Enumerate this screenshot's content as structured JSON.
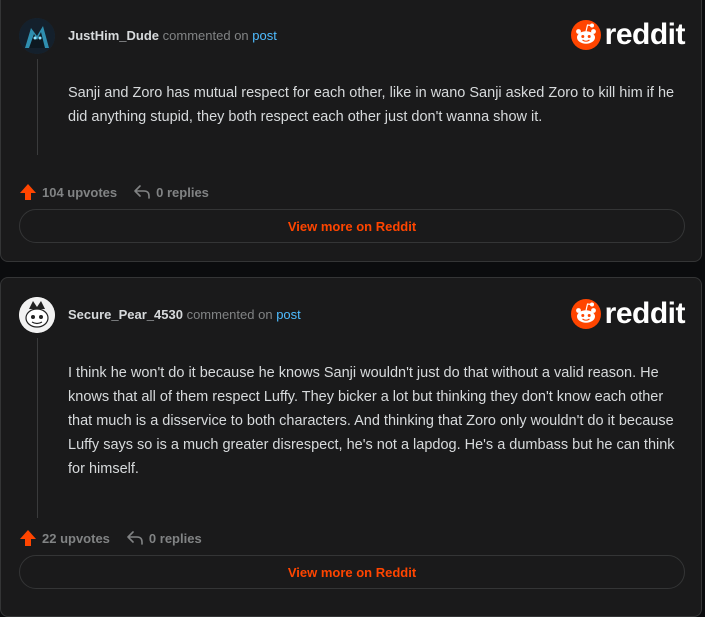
{
  "brand": {
    "wordmark": "reddit",
    "accent": "#ff4500",
    "link_color": "#4fbcff"
  },
  "comments": [
    {
      "username": "JustHim_Dude",
      "action": "commented on",
      "post_link": "post",
      "text": "Sanji and Zoro has mutual respect for each other, like in wano Sanji asked Zoro to kill him if he did anything stupid, they both respect each other just don't wanna show it.",
      "upvotes": "104 upvotes",
      "replies": "0 replies",
      "view_more": "View more on Reddit",
      "avatar_icon": "dark-character-avatar"
    },
    {
      "username": "Secure_Pear_4530",
      "action": "commented on",
      "post_link": "post",
      "text": "I think he won't do it because he knows Sanji wouldn't just do that without a valid reason. He knows that all of them respect Luffy. They bicker a lot but thinking they don't know each other that much is a disservice to both characters. And thinking that Zoro only wouldn't do it because Luffy says so is a much greater disrespect, he's not a lapdog. He's a dumbass but he can think for himself.",
      "upvotes": "22 upvotes",
      "replies": "0 replies",
      "view_more": "View more on Reddit",
      "avatar_icon": "snoo-avatar"
    }
  ]
}
